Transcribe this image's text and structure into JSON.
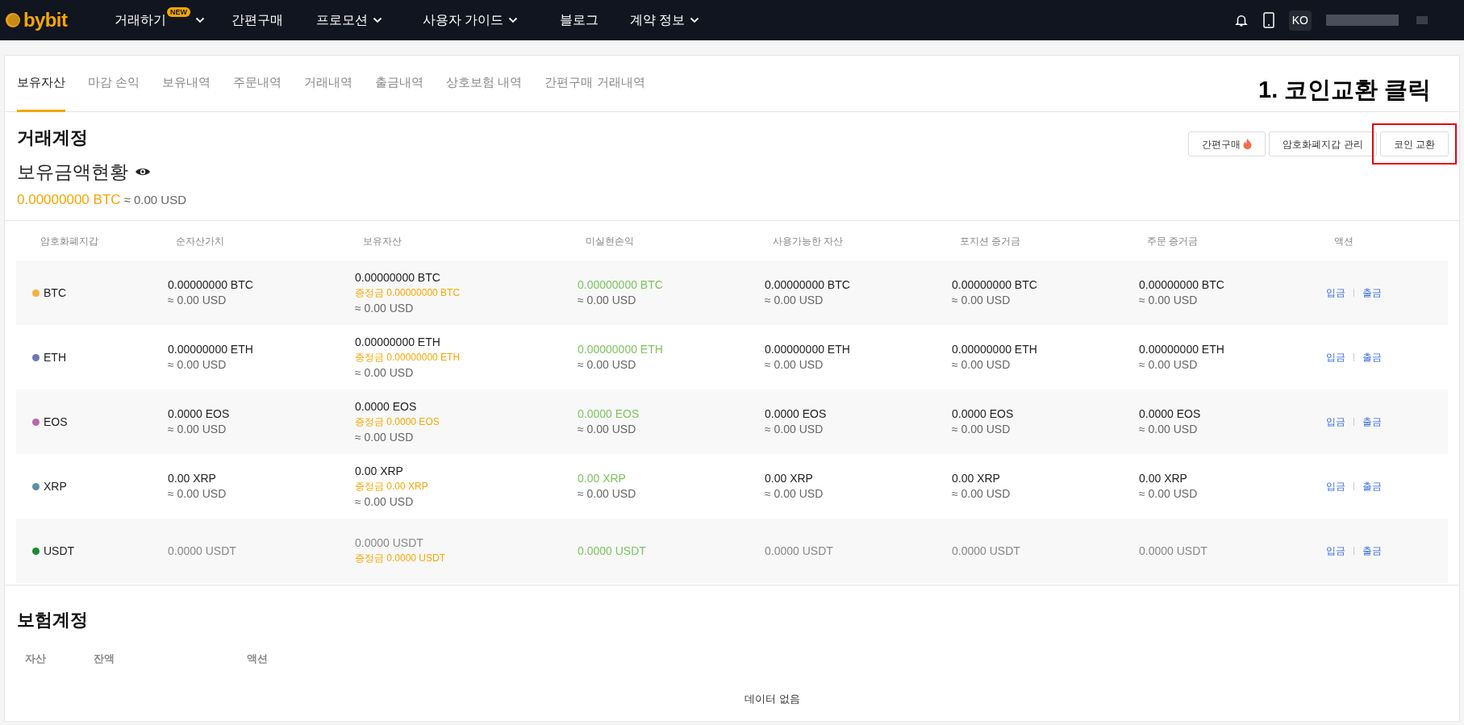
{
  "logo": "bybit",
  "nav": {
    "items": [
      {
        "label": "거래하기",
        "badge": "NEW",
        "dropdown": true
      },
      {
        "label": "간편구매",
        "dropdown": false
      },
      {
        "label": "프로모션",
        "dropdown": true
      },
      {
        "label": "사용자 가이드",
        "dropdown": true
      },
      {
        "label": "블로그",
        "dropdown": false
      },
      {
        "label": "계약 정보",
        "dropdown": true
      }
    ],
    "language": "KO"
  },
  "tabs": [
    {
      "label": "보유자산",
      "selected": true
    },
    {
      "label": "마감 손익",
      "selected": false
    },
    {
      "label": "보유내역",
      "selected": false
    },
    {
      "label": "주문내역",
      "selected": false
    },
    {
      "label": "거래내역",
      "selected": false
    },
    {
      "label": "출금내역",
      "selected": false
    },
    {
      "label": "상호보험 내역",
      "selected": false
    },
    {
      "label": "간편구매 거래내역",
      "selected": false
    }
  ],
  "annotation": "1. 코인교환 클릭",
  "trading_account": {
    "title": "거래계정",
    "buttons": [
      {
        "label": "간편구매",
        "hot": true,
        "highlighted": false
      },
      {
        "label": "암호화폐지갑 관리",
        "hot": false,
        "highlighted": false
      },
      {
        "label": "코인 교환",
        "hot": false,
        "highlighted": true
      }
    ],
    "balance_title": "보유금액현황",
    "balance_btc": "0.00000000 BTC",
    "balance_usd": "≈ 0.00 USD",
    "columns": [
      "암호화폐지갑",
      "순자산가치",
      "보유자산",
      "미실현손익",
      "사용가능한 자산",
      "포지션 증거금",
      "주문 증거금",
      "액션"
    ],
    "rows": [
      {
        "asset": "BTC",
        "color": "#f5b13d",
        "net": {
          "amount": "0.00000000 BTC",
          "usd": "≈ 0.00 USD"
        },
        "holdings": {
          "amount": "0.00000000 BTC",
          "margin": "증정금 0.00000000 BTC",
          "usd": "≈ 0.00 USD"
        },
        "unrealized": {
          "amount": "0.00000000 BTC",
          "usd": "≈ 0.00 USD"
        },
        "available": {
          "amount": "0.00000000 BTC",
          "usd": "≈ 0.00 USD"
        },
        "position_margin": {
          "amount": "0.00000000 BTC",
          "usd": "≈ 0.00 USD"
        },
        "order_margin": {
          "amount": "0.00000000 BTC",
          "usd": "≈ 0.00 USD"
        },
        "actions": [
          "입금",
          "출금"
        ]
      },
      {
        "asset": "ETH",
        "color": "#7078b5",
        "net": {
          "amount": "0.00000000 ETH",
          "usd": "≈ 0.00 USD"
        },
        "holdings": {
          "amount": "0.00000000 ETH",
          "margin": "증정금 0.00000000 ETH",
          "usd": "≈ 0.00 USD"
        },
        "unrealized": {
          "amount": "0.00000000 ETH",
          "usd": "≈ 0.00 USD"
        },
        "available": {
          "amount": "0.00000000 ETH",
          "usd": "≈ 0.00 USD"
        },
        "position_margin": {
          "amount": "0.00000000 ETH",
          "usd": "≈ 0.00 USD"
        },
        "order_margin": {
          "amount": "0.00000000 ETH",
          "usd": "≈ 0.00 USD"
        },
        "actions": [
          "입금",
          "출금"
        ]
      },
      {
        "asset": "EOS",
        "color": "#b869a8",
        "net": {
          "amount": "0.0000 EOS",
          "usd": "≈ 0.00 USD"
        },
        "holdings": {
          "amount": "0.0000 EOS",
          "margin": "증정금 0.0000 EOS",
          "usd": "≈ 0.00 USD"
        },
        "unrealized": {
          "amount": "0.0000 EOS",
          "usd": "≈ 0.00 USD"
        },
        "available": {
          "amount": "0.0000 EOS",
          "usd": "≈ 0.00 USD"
        },
        "position_margin": {
          "amount": "0.0000 EOS",
          "usd": "≈ 0.00 USD"
        },
        "order_margin": {
          "amount": "0.0000 EOS",
          "usd": "≈ 0.00 USD"
        },
        "actions": [
          "입금",
          "출금"
        ]
      },
      {
        "asset": "XRP",
        "color": "#5b8ea8",
        "net": {
          "amount": "0.00 XRP",
          "usd": "≈ 0.00 USD"
        },
        "holdings": {
          "amount": "0.00 XRP",
          "margin": "증정금 0.00 XRP",
          "usd": "≈ 0.00 USD"
        },
        "unrealized": {
          "amount": "0.00 XRP",
          "usd": "≈ 0.00 USD"
        },
        "available": {
          "amount": "0.00 XRP",
          "usd": "≈ 0.00 USD"
        },
        "position_margin": {
          "amount": "0.00 XRP",
          "usd": "≈ 0.00 USD"
        },
        "order_margin": {
          "amount": "0.00 XRP",
          "usd": "≈ 0.00 USD"
        },
        "actions": [
          "입금",
          "출금"
        ]
      },
      {
        "asset": "USDT",
        "color": "#1c8a33",
        "net": {
          "amount": "0.0000 USDT"
        },
        "holdings": {
          "amount": "0.0000 USDT",
          "margin": "증정금 0.0000 USDT"
        },
        "unrealized": {
          "amount": "0.0000 USDT"
        },
        "available": {
          "amount": "0.0000 USDT"
        },
        "position_margin": {
          "amount": "0.0000 USDT"
        },
        "order_margin": {
          "amount": "0.0000 USDT"
        },
        "actions": [
          "입금",
          "출금"
        ]
      }
    ]
  },
  "insurance_account": {
    "title": "보험계정",
    "columns": [
      "자산",
      "잔액",
      "액션"
    ],
    "empty_text": "데이터 없음"
  }
}
